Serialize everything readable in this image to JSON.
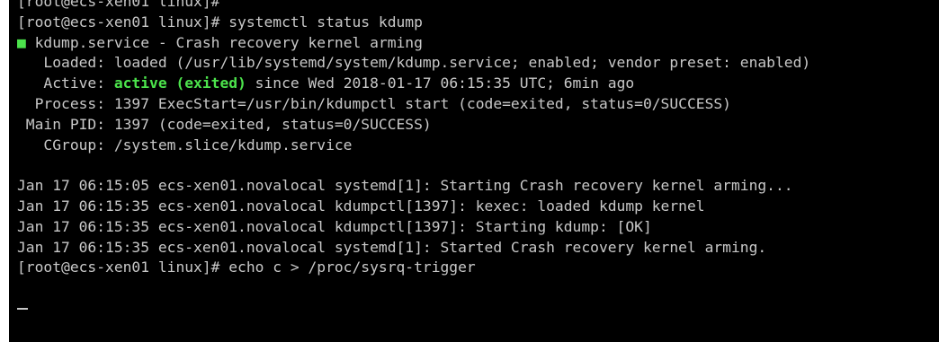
{
  "terminal": {
    "cut_top_line": "[root@ecs-xen01 linux]#",
    "prompt1": "[root@ecs-xen01 linux]# systemctl status kdump",
    "service_bullet": "■",
    "service_line": " kdump.service - Crash recovery kernel arming",
    "loaded_line": "   Loaded: loaded (/usr/lib/systemd/system/kdump.service; enabled; vendor preset: enabled)",
    "active_label": "   Active: ",
    "active_status": "active (exited)",
    "active_rest": " since Wed 2018-01-17 06:15:35 UTC; 6min ago",
    "process_line": "  Process: 1397 ExecStart=/usr/bin/kdumpctl start (code=exited, status=0/SUCCESS)",
    "mainpid_line": " Main PID: 1397 (code=exited, status=0/SUCCESS)",
    "cgroup_line": "   CGroup: /system.slice/kdump.service",
    "log_lines": [
      "Jan 17 06:15:05 ecs-xen01.novalocal systemd[1]: Starting Crash recovery kernel arming...",
      "Jan 17 06:15:35 ecs-xen01.novalocal kdumpctl[1397]: kexec: loaded kdump kernel",
      "Jan 17 06:15:35 ecs-xen01.novalocal kdumpctl[1397]: Starting kdump: [OK]",
      "Jan 17 06:15:35 ecs-xen01.novalocal systemd[1]: Started Crash recovery kernel arming."
    ],
    "prompt2": "[root@ecs-xen01 linux]# echo c > /proc/sysrq-trigger"
  },
  "colors": {
    "background": "#000000",
    "text": "#c8c8c8",
    "active_green": "#4ce34c"
  }
}
